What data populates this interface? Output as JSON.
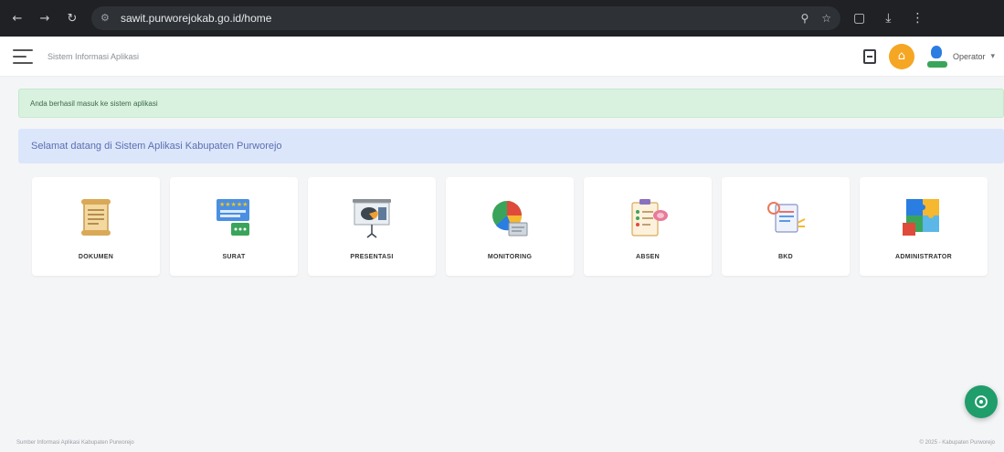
{
  "browser": {
    "url": "sawit.purworejokab.go.id/home",
    "icons": [
      "back-icon",
      "forward-icon",
      "reload-icon",
      "site-info-icon",
      "zoom-icon",
      "bookmark-star-icon",
      "extensions-icon",
      "download-icon",
      "menu-icon"
    ]
  },
  "topbar": {
    "title": "Sistem Informasi Aplikasi",
    "user_name": "Operator"
  },
  "alerts": {
    "success": "Anda berhasil masuk ke sistem aplikasi",
    "welcome": "Selamat datang di Sistem Aplikasi Kabupaten Purworejo"
  },
  "modules": [
    {
      "label": "DOKUMEN",
      "icon": "document-scroll-icon"
    },
    {
      "label": "SURAT",
      "icon": "rating-card-icon"
    },
    {
      "label": "PRESENTASI",
      "icon": "presentation-board-icon"
    },
    {
      "label": "MONITORING",
      "icon": "pie-chart-icon"
    },
    {
      "label": "ABSEN",
      "icon": "clipboard-checklist-icon"
    },
    {
      "label": "BKD",
      "icon": "settings-document-icon"
    },
    {
      "label": "ADMINISTRATOR",
      "icon": "puzzle-icon"
    }
  ],
  "footer": {
    "left": "Sumber Informasi Aplikasi Kabupaten Purworejo",
    "right": "© 2025 - Kabupaten Purworejo"
  },
  "colors": {
    "browser_bar": "#1f2124",
    "success_bg": "#d9f2df",
    "welcome_bg": "#dce6fb",
    "welcome_text": "#5a6fb0",
    "fab": "#1f9d6b",
    "home": "#f5a623"
  }
}
